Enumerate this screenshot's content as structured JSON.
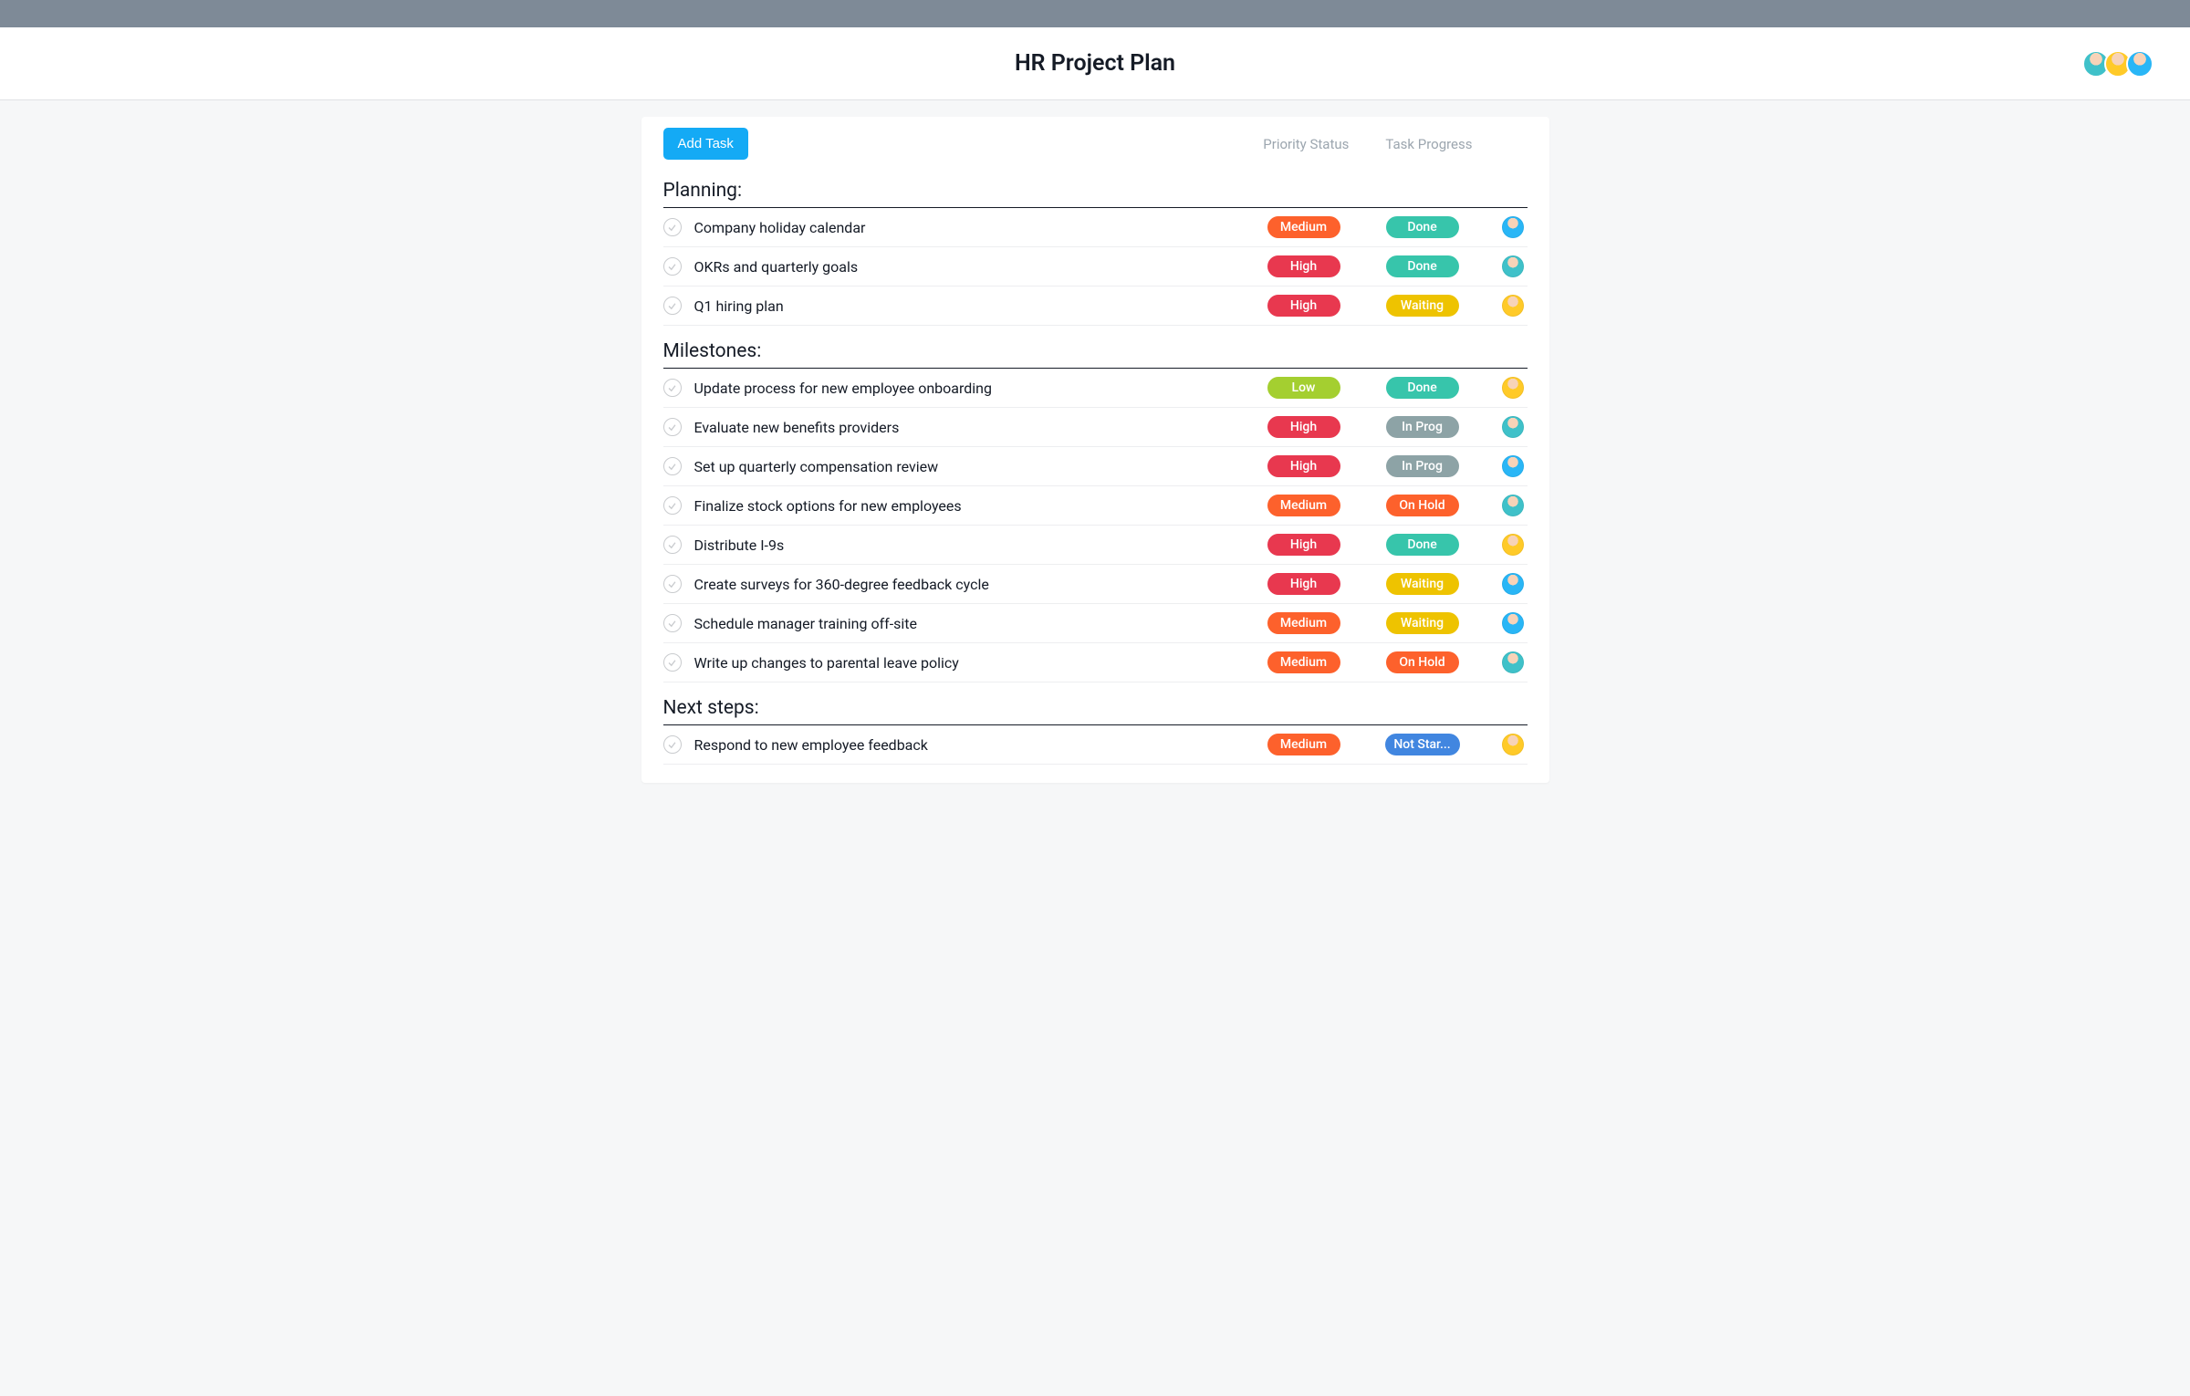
{
  "header": {
    "title": "HR Project Plan",
    "avatars": [
      "teal",
      "yellow",
      "blue"
    ]
  },
  "toolbar": {
    "add_task_label": "Add Task",
    "priority_label": "Priority Status",
    "progress_label": "Task Progress"
  },
  "priority_colors": {
    "High": "pill-high",
    "Medium": "pill-medium",
    "Low": "pill-low"
  },
  "progress_colors": {
    "Done": "pill-done",
    "Waiting": "pill-waiting",
    "In Prog": "pill-inprog",
    "On Hold": "pill-onhold",
    "Not Star...": "pill-notstarted"
  },
  "avatar_colors": {
    "teal": "avatar-teal",
    "yellow": "avatar-yellow",
    "blue": "avatar-blue",
    "green": "avatar-green"
  },
  "sections": [
    {
      "title": "Planning:",
      "tasks": [
        {
          "name": "Company holiday calendar",
          "priority": "Medium",
          "progress": "Done",
          "avatar": "blue"
        },
        {
          "name": "OKRs and quarterly goals",
          "priority": "High",
          "progress": "Done",
          "avatar": "teal"
        },
        {
          "name": "Q1 hiring plan",
          "priority": "High",
          "progress": "Waiting",
          "avatar": "yellow"
        }
      ]
    },
    {
      "title": "Milestones:",
      "tasks": [
        {
          "name": "Update process for new employee onboarding",
          "priority": "Low",
          "progress": "Done",
          "avatar": "yellow"
        },
        {
          "name": "Evaluate new benefits providers",
          "priority": "High",
          "progress": "In Prog",
          "avatar": "teal"
        },
        {
          "name": "Set up quarterly compensation review",
          "priority": "High",
          "progress": "In Prog",
          "avatar": "blue"
        },
        {
          "name": "Finalize stock options for new employees",
          "priority": "Medium",
          "progress": "On Hold",
          "avatar": "teal"
        },
        {
          "name": "Distribute I-9s",
          "priority": "High",
          "progress": "Done",
          "avatar": "yellow"
        },
        {
          "name": "Create surveys for 360-degree feedback cycle",
          "priority": "High",
          "progress": "Waiting",
          "avatar": "blue"
        },
        {
          "name": "Schedule manager training off-site",
          "priority": "Medium",
          "progress": "Waiting",
          "avatar": "blue"
        },
        {
          "name": "Write up changes to parental leave policy",
          "priority": "Medium",
          "progress": "On Hold",
          "avatar": "teal"
        }
      ]
    },
    {
      "title": "Next steps:",
      "tasks": [
        {
          "name": "Respond to new employee feedback",
          "priority": "Medium",
          "progress": "Not Star...",
          "avatar": "yellow"
        }
      ]
    }
  ]
}
